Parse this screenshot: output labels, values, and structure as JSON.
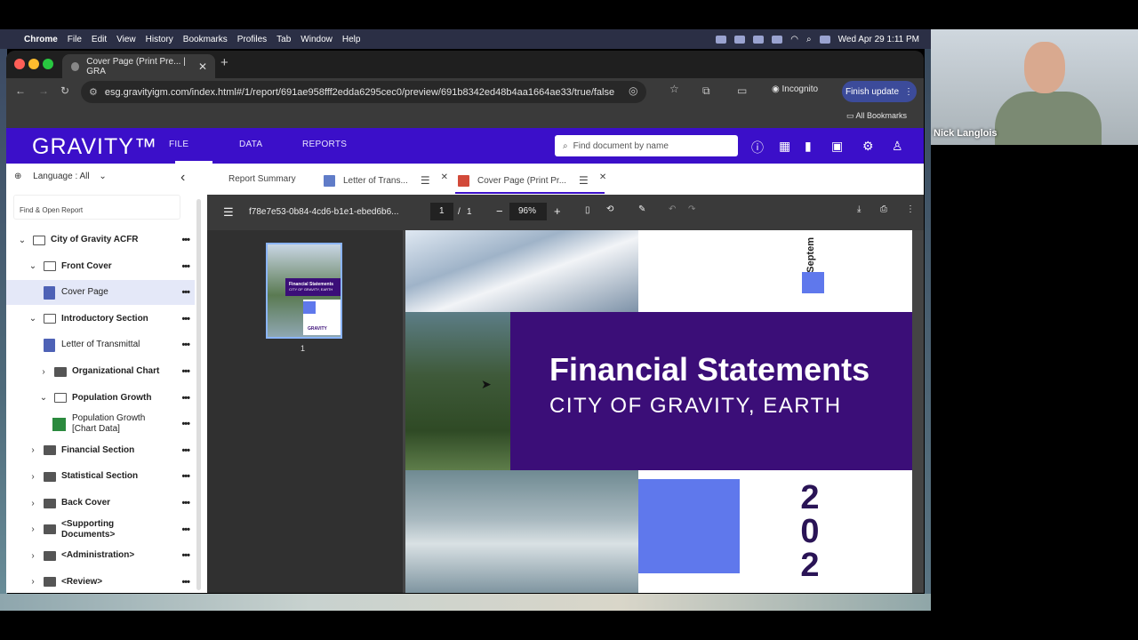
{
  "menubar": {
    "app": "Chrome",
    "items": [
      "File",
      "Edit",
      "View",
      "History",
      "Bookmarks",
      "Profiles",
      "Tab",
      "Window",
      "Help"
    ],
    "datetime": "Wed Apr 29  1:11 PM"
  },
  "browser": {
    "tab_title": "Cover Page (Print Pre... | GRA",
    "url": "esg.gravityigm.com/index.html#/1/report/691ae958fff2edda6295cec0/preview/691b8342ed48b4aa1664ae33/true/false",
    "incognito_label": "Incognito",
    "finish_update_label": "Finish update",
    "all_bookmarks_label": "All Bookmarks"
  },
  "app": {
    "logo": "GRAVITY™",
    "nav": [
      "FILE",
      "DATA",
      "REPORTS"
    ],
    "search_placeholder": "Find document by name",
    "accent": "#3b0fc9"
  },
  "sidebar": {
    "language_label": "Language : All",
    "find_placeholder": "Find & Open Report",
    "items": [
      {
        "label": "City of Gravity ACFR",
        "level": 0,
        "type": "folder",
        "chevron": "open"
      },
      {
        "label": "Front Cover",
        "level": 1,
        "type": "folder",
        "chevron": "open"
      },
      {
        "label": "Cover Page",
        "level": 2,
        "type": "doc",
        "selected": true
      },
      {
        "label": "Introductory Section",
        "level": 1,
        "type": "folder",
        "chevron": "open"
      },
      {
        "label": "Letter of Transmittal",
        "level": 2,
        "type": "doc"
      },
      {
        "label": "Organizational Chart",
        "level": 2,
        "type": "folder-filled",
        "chevron": "closed"
      },
      {
        "label": "Population Growth",
        "level": 2,
        "type": "folder",
        "chevron": "open"
      },
      {
        "label": "Population Growth\n[Chart Data]",
        "level": 3,
        "type": "sheet"
      },
      {
        "label": "Financial Section",
        "level": 1,
        "type": "folder-filled",
        "chevron": "closed"
      },
      {
        "label": "Statistical Section",
        "level": 1,
        "type": "folder-filled",
        "chevron": "closed"
      },
      {
        "label": "Back Cover",
        "level": 1,
        "type": "folder-filled",
        "chevron": "closed"
      },
      {
        "label": "<Supporting\nDocuments>",
        "level": 1,
        "type": "folder-filled",
        "chevron": "closed"
      },
      {
        "label": "<Administration>",
        "level": 1,
        "type": "folder-filled",
        "chevron": "closed"
      },
      {
        "label": "<Review>",
        "level": 1,
        "type": "folder-filled",
        "chevron": "closed"
      }
    ]
  },
  "doc_tabs": {
    "report_summary": "Report Summary",
    "letter": "Letter of Trans...",
    "cover": "Cover Page (Print Pr..."
  },
  "pdf": {
    "filename": "f78e7e53-0b84-4cd6-b1e1-ebed6b6...",
    "page": "1",
    "page_sep": "/",
    "total_pages": "1",
    "zoom": "96%",
    "thumb_number": "1",
    "thumb_title": "Financial Statements",
    "thumb_sub": "CITY OF GRAVITY, EARTH",
    "thumb_brand": "GRAVITY"
  },
  "cover": {
    "title": "Financial Statements",
    "subtitle": "CITY OF GRAVITY, EARTH",
    "month_partial": "Septem",
    "year_digits": [
      "2",
      "0",
      "2"
    ]
  },
  "webcam": {
    "name": "Nick Langlois"
  }
}
